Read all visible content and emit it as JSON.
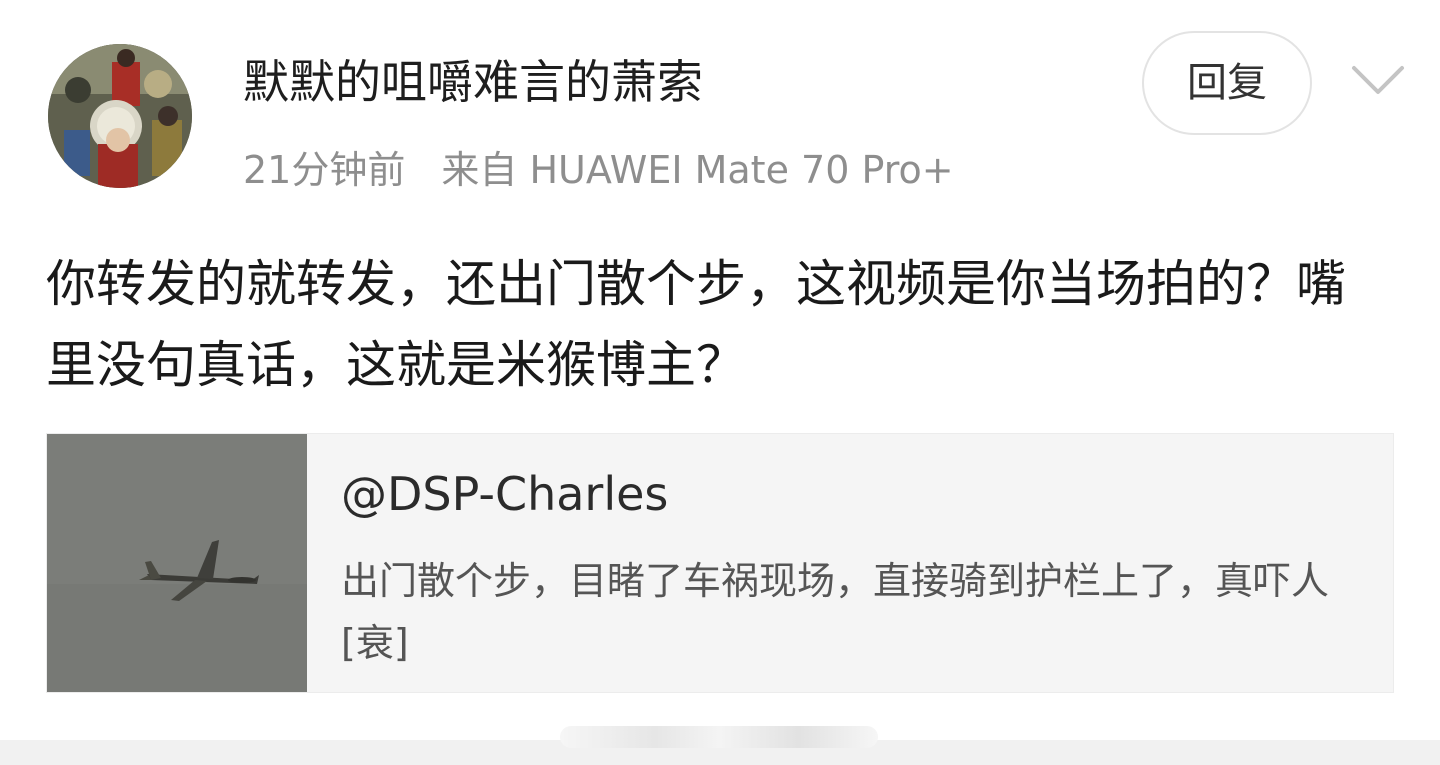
{
  "comment": {
    "avatar_icon": "user-avatar-icon",
    "username": "默默的咀嚼难言的萧索",
    "time": "21分钟前",
    "source": "来自 HUAWEI Mate 70 Pro+",
    "reply_label": "回复",
    "more_icon": "chevron-down-icon",
    "text": "你转发的就转发，还出门散个步，这视频是你当场拍的？嘴里没句真话，这就是米猴博主？"
  },
  "quote": {
    "thumbnail_icon": "airplane-thumbnail-icon",
    "author": "@DSP-Charles",
    "text": "出门散个步，目睹了车祸现场，直接骑到护栏上了，真吓人[衰]"
  },
  "colors": {
    "text_primary": "#1a1a1a",
    "text_secondary": "#8e8e8e",
    "card_background": "#f5f5f5",
    "button_border": "#e3e3e3"
  }
}
